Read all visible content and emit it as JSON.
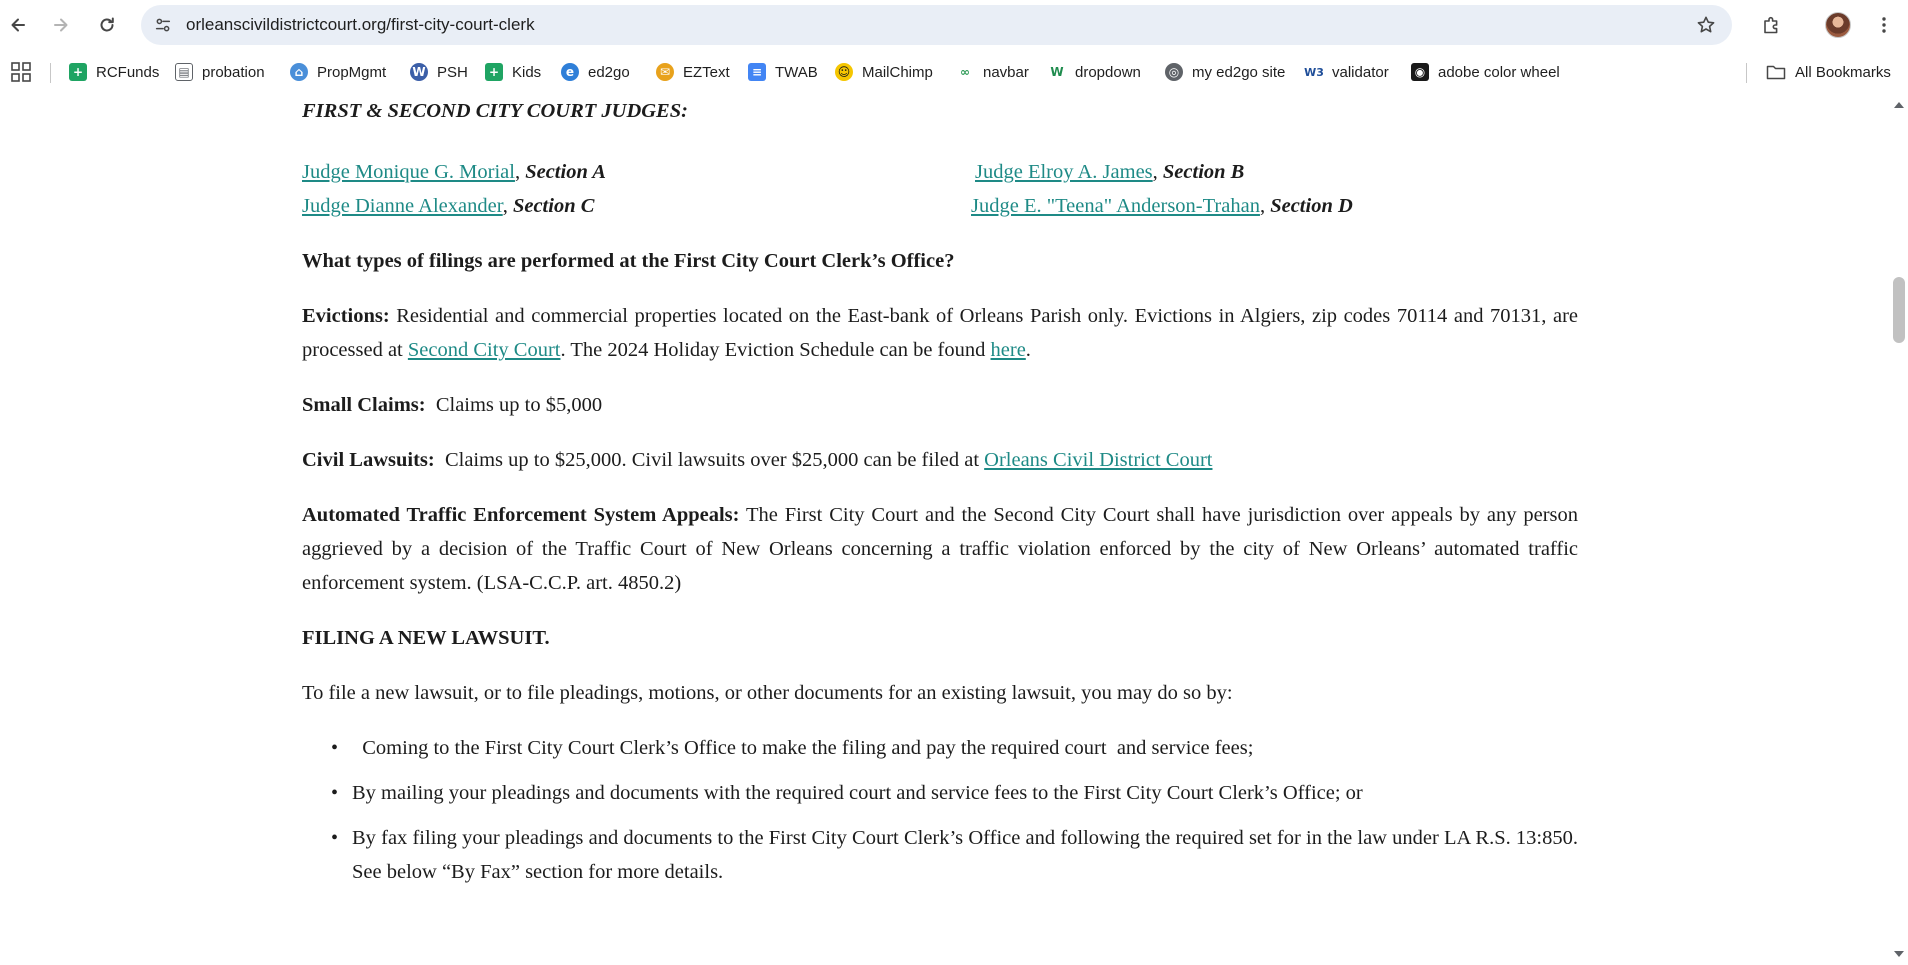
{
  "browser": {
    "url": "orleanscivildistrictcourt.org/first-city-court-clerk",
    "bookmarks": [
      {
        "label": "RCFunds",
        "icon": "sheets-icon",
        "color": "#1fa463"
      },
      {
        "label": "probation",
        "icon": "document-person-icon",
        "color": "#5f6368"
      },
      {
        "label": "PropMgmt",
        "icon": "propmgmt-icon",
        "color": "#4a8fd9"
      },
      {
        "label": "PSH",
        "icon": "wordpress-icon",
        "color": "#3c5fa8"
      },
      {
        "label": "Kids",
        "icon": "sheets-icon",
        "color": "#1fa463"
      },
      {
        "label": "ed2go",
        "icon": "ed2go-icon",
        "color": "#2f7fd8"
      },
      {
        "label": "EZText",
        "icon": "eztext-icon",
        "color": "#e8a21c"
      },
      {
        "label": "TWAB",
        "icon": "docs-icon",
        "color": "#4285f4"
      },
      {
        "label": "MailChimp",
        "icon": "mailchimp-icon",
        "color": "#f5c600"
      },
      {
        "label": "navbar",
        "icon": "navbar-icon",
        "color": "#2e9a57"
      },
      {
        "label": "dropdown",
        "icon": "dropdown-icon",
        "color": "#1f8c4e"
      },
      {
        "label": "my ed2go site",
        "icon": "globe-icon",
        "color": "#5f6368"
      },
      {
        "label": "validator",
        "icon": "w3c-icon",
        "color": "#1f4e99"
      },
      {
        "label": "adobe color wheel",
        "icon": "adobe-color-icon",
        "color": "#1a1a1a"
      }
    ],
    "all_bookmarks_label": "All Bookmarks"
  },
  "content": {
    "judges_heading": "FIRST & SECOND CITY COURT JUDGES:",
    "judges": [
      {
        "name": "Judge Monique G. Morial",
        "section": "Section A"
      },
      {
        "name": "Judge Elroy A. James",
        "section": "Section B"
      },
      {
        "name": "Judge Dianne Alexander",
        "section": "Section C"
      },
      {
        "name": "Judge E. \"Teena\" Anderson-Trahan",
        "section": "Section D"
      }
    ],
    "filings_question": "What types of filings are performed at the First City Court Clerk’s Office?",
    "evictions": {
      "label": "Evictions:",
      "text1": " Residential and commercial properties located on the East-bank of Orleans Parish only.  Evictions in Algiers, zip codes 70114 and 70131, are processed at ",
      "link1": "Second City Court",
      "text2": ".  The 2024 Holiday Eviction Schedule can be found ",
      "link2": "here",
      "text3": "."
    },
    "small_claims": {
      "label": "Small Claims:",
      "text": "  Claims up to $5,000"
    },
    "civil_lawsuits": {
      "label": "Civil Lawsuits:",
      "text": "  Claims up to $25,000. Civil lawsuits over $25,000 can be filed at ",
      "link": "Orleans Civil District Court"
    },
    "traffic_appeals": {
      "label": "Automated Traffic Enforcement System Appeals:",
      "text": "  The First City Court and the Second City Court shall have jurisdiction over appeals by any person aggrieved by a decision of the Traffic Court of New Orleans concerning a traffic violation enforced by the city of New Orleans’  automated traffic enforcement system. (LSA-C.C.P. art. 4850.2)"
    },
    "filing_heading": "FILING A NEW LAWSUIT.",
    "filing_intro": "To file a new lawsuit, or to file pleadings, motions, or other documents for an existing lawsuit, you may do so by:",
    "filing_methods": [
      "  Coming to the First City Court Clerk’s Office to make the filing and pay the required court  and service fees;",
      "By mailing your pleadings and documents with the required court and service fees to the First City Court Clerk’s Office; or",
      "By fax filing your pleadings and documents to the First City Court Clerk’s Office and following the required set for in the law under LA R.S. 13:850.  See below “By Fax” section for more details."
    ],
    "bullet_char": "•"
  }
}
